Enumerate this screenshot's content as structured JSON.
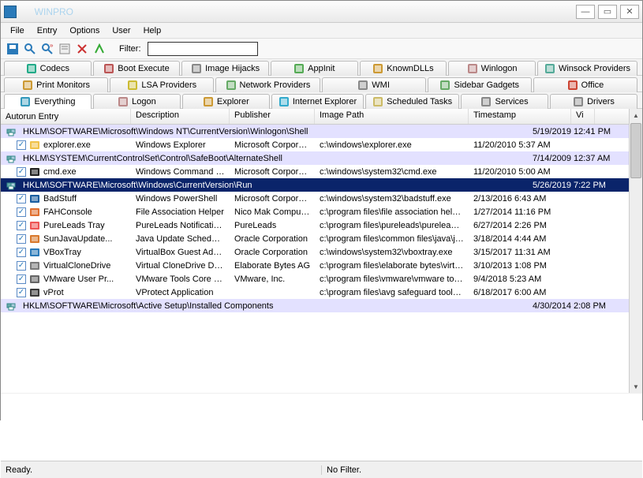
{
  "window": {
    "title": "     WINPRO                                       "
  },
  "menu": [
    "File",
    "Entry",
    "Options",
    "User",
    "Help"
  ],
  "toolbar": {
    "filter_label": "Filter:",
    "filter_value": ""
  },
  "tabs_row1": [
    {
      "label": "Codecs",
      "icon": "codecs-icon"
    },
    {
      "label": "Boot Execute",
      "icon": "boot-icon"
    },
    {
      "label": "Image Hijacks",
      "icon": "hijack-icon"
    },
    {
      "label": "AppInit",
      "icon": "appinit-icon"
    },
    {
      "label": "KnownDLLs",
      "icon": "dll-icon"
    },
    {
      "label": "Winlogon",
      "icon": "winlogon-icon"
    },
    {
      "label": "Winsock Providers",
      "icon": "winsock-icon"
    }
  ],
  "tabs_row2": [
    {
      "label": "Print Monitors",
      "icon": "print-icon"
    },
    {
      "label": "LSA Providers",
      "icon": "lsa-icon"
    },
    {
      "label": "Network Providers",
      "icon": "network-icon"
    },
    {
      "label": "WMI",
      "icon": "wmi-icon"
    },
    {
      "label": "Sidebar Gadgets",
      "icon": "gadget-icon"
    },
    {
      "label": "Office",
      "icon": "office-icon"
    }
  ],
  "tabs_row3": [
    {
      "label": "Everything",
      "icon": "everything-icon",
      "active": true
    },
    {
      "label": "Logon",
      "icon": "logon-icon"
    },
    {
      "label": "Explorer",
      "icon": "explorer-icon"
    },
    {
      "label": "Internet Explorer",
      "icon": "ie-icon"
    },
    {
      "label": "Scheduled Tasks",
      "icon": "tasks-icon"
    },
    {
      "label": "Services",
      "icon": "services-icon"
    },
    {
      "label": "Drivers",
      "icon": "drivers-icon"
    }
  ],
  "columns": [
    "Autorun Entry",
    "Description",
    "Publisher",
    "Image Path",
    "Timestamp",
    "Vi"
  ],
  "rows": [
    {
      "type": "header",
      "label": "HKLM\\SOFTWARE\\Microsoft\\Windows NT\\CurrentVersion\\Winlogon\\Shell",
      "time": "5/19/2019 12:41 PM"
    },
    {
      "type": "item",
      "checked": true,
      "icon": "folder-icon",
      "iconColor": "#f0c24a",
      "name": "explorer.exe",
      "desc": "Windows Explorer",
      "pub": "Microsoft Corporation",
      "path": "c:\\windows\\explorer.exe",
      "time": "11/20/2010 5:37 AM"
    },
    {
      "type": "header",
      "label": "HKLM\\SYSTEM\\CurrentControlSet\\Control\\SafeBoot\\AlternateShell",
      "time": "7/14/2009 12:37 AM"
    },
    {
      "type": "item",
      "checked": true,
      "icon": "cmd-icon",
      "iconColor": "#222",
      "name": "cmd.exe",
      "desc": "Windows Command Pro...",
      "pub": "Microsoft Corporation",
      "path": "c:\\windows\\system32\\cmd.exe",
      "time": "11/20/2010 5:00 AM"
    },
    {
      "type": "header",
      "selected": true,
      "label": "HKLM\\SOFTWARE\\Microsoft\\Windows\\CurrentVersion\\Run",
      "time": "5/26/2019 7:22 PM"
    },
    {
      "type": "item",
      "checked": true,
      "icon": "ps-icon",
      "iconColor": "#1a5ea0",
      "name": "BadStuff",
      "desc": "Windows PowerShell",
      "pub": "Microsoft Corporation",
      "path": "c:\\windows\\system32\\badstuff.exe",
      "time": "2/13/2016 6:43 AM"
    },
    {
      "type": "item",
      "checked": true,
      "icon": "fah-icon",
      "iconColor": "#e07030",
      "name": "FAHConsole",
      "desc": "File Association Helper",
      "pub": "Nico Mak Computing",
      "path": "c:\\program files\\file association helpe...",
      "time": "1/27/2014 11:16 PM"
    },
    {
      "type": "item",
      "checked": true,
      "icon": "pl-icon",
      "iconColor": "#e55",
      "name": "PureLeads Tray",
      "desc": "PureLeads Notification I...",
      "pub": "PureLeads",
      "path": "c:\\program files\\pureleads\\pureleads...",
      "time": "6/27/2014 2:26 PM"
    },
    {
      "type": "item",
      "checked": true,
      "icon": "java-icon",
      "iconColor": "#d97a2e",
      "name": "SunJavaUpdate...",
      "desc": "Java Update Scheduler",
      "pub": "Oracle Corporation",
      "path": "c:\\program files\\common files\\java\\ja...",
      "time": "3/18/2014 4:44 AM"
    },
    {
      "type": "item",
      "checked": true,
      "icon": "vbox-icon",
      "iconColor": "#2a7ab9",
      "name": "VBoxTray",
      "desc": "VirtualBox Guest Additio...",
      "pub": "Oracle Corporation",
      "path": "c:\\windows\\system32\\vboxtray.exe",
      "time": "3/15/2017 11:31 AM"
    },
    {
      "type": "item",
      "checked": true,
      "icon": "vcd-icon",
      "iconColor": "#7a7a7a",
      "name": "VirtualCloneDrive",
      "desc": "Virtual CloneDrive Dae...",
      "pub": "Elaborate Bytes AG",
      "path": "c:\\program files\\elaborate bytes\\virtu...",
      "time": "3/10/2013 1:08 PM"
    },
    {
      "type": "item",
      "checked": true,
      "icon": "vmw-icon",
      "iconColor": "#666",
      "name": "VMware User Pr...",
      "desc": "VMware Tools Core Ser...",
      "pub": "VMware, Inc.",
      "path": "c:\\program files\\vmware\\vmware tool...",
      "time": "9/4/2018 5:23 AM"
    },
    {
      "type": "item",
      "checked": true,
      "icon": "vprot-icon",
      "iconColor": "#3a3a3a",
      "name": "vProt",
      "desc": "VProtect Application",
      "pub": "",
      "path": "c:\\program files\\avg safeguard toolb...",
      "time": "6/18/2017 6:00 AM"
    },
    {
      "type": "header",
      "label": "HKLM\\SOFTWARE\\Microsoft\\Active Setup\\Installed Components",
      "time": "4/30/2014 2:08 PM"
    }
  ],
  "status": {
    "left": "Ready.",
    "right": "No Filter."
  },
  "icon_colors": {
    "codecs-icon": "#2a8",
    "boot-icon": "#b55",
    "hijack-icon": "#888",
    "appinit-icon": "#5a5",
    "dll-icon": "#c93",
    "winlogon-icon": "#b88",
    "winsock-icon": "#5a9",
    "print-icon": "#c93",
    "lsa-icon": "#cb3",
    "network-icon": "#6a6",
    "wmi-icon": "#888",
    "gadget-icon": "#6a6",
    "office-icon": "#c43",
    "everything-icon": "#39b",
    "logon-icon": "#b88",
    "explorer-icon": "#c93",
    "ie-icon": "#3ac",
    "tasks-icon": "#cb6",
    "services-icon": "#888",
    "drivers-icon": "#888"
  }
}
